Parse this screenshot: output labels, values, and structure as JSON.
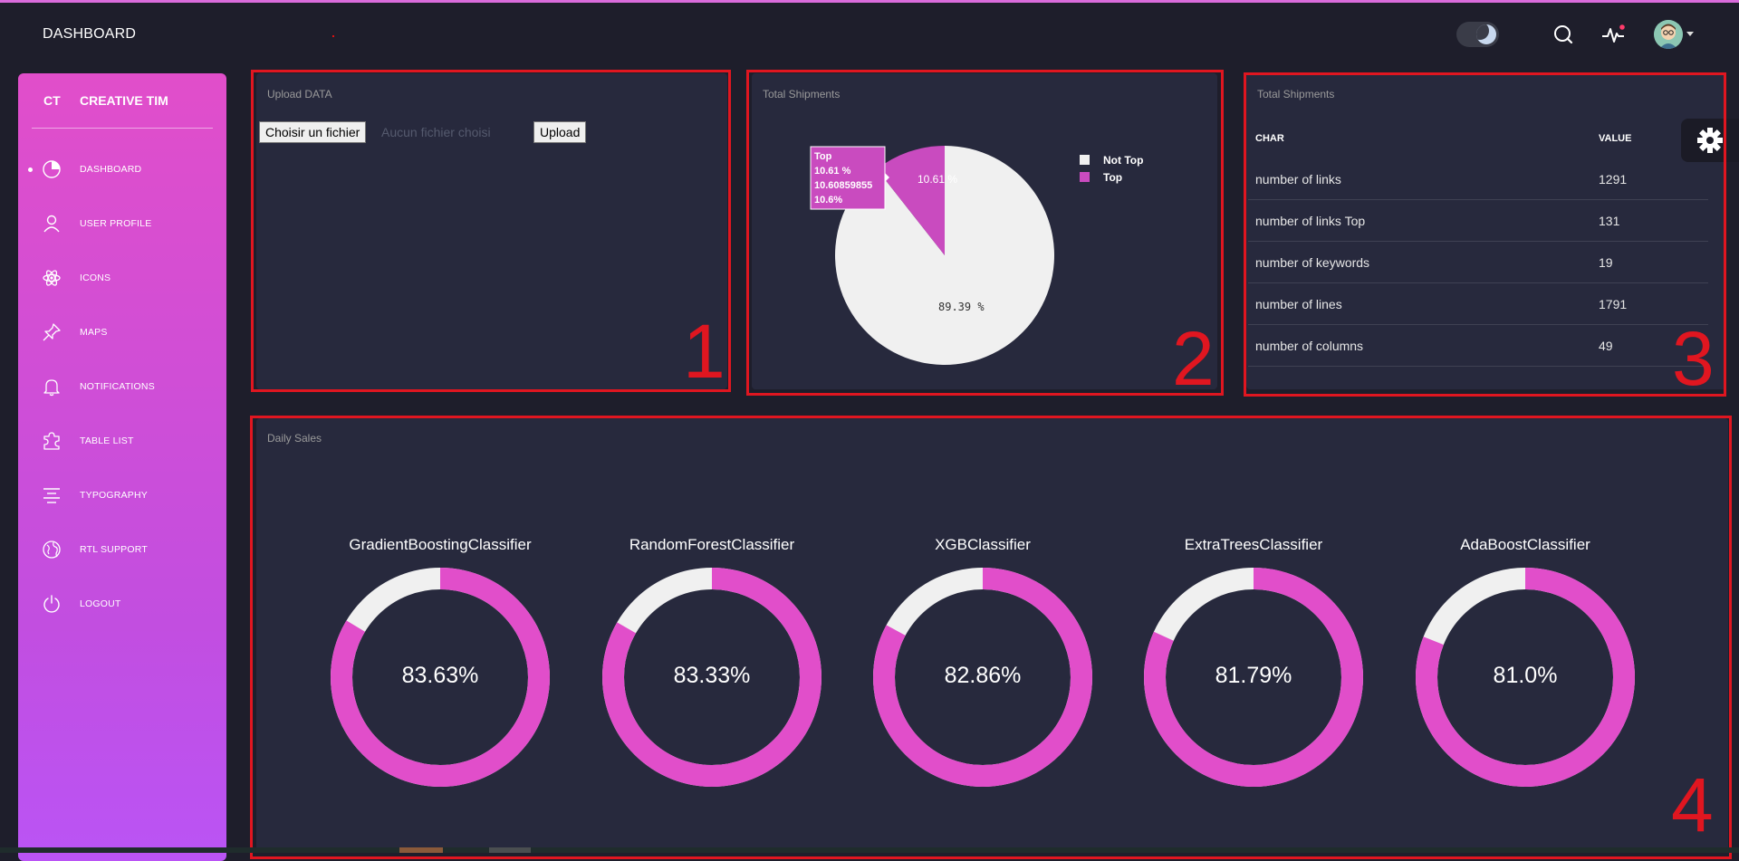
{
  "header": {
    "title": "DASHBOARD"
  },
  "sidebar": {
    "logo_short": "CT",
    "logo_text": "CREATIVE TIM",
    "items": [
      {
        "label": "DASHBOARD",
        "icon": "chart-pie-icon",
        "active": true
      },
      {
        "label": "USER PROFILE",
        "icon": "user-icon",
        "active": false
      },
      {
        "label": "ICONS",
        "icon": "atom-icon",
        "active": false
      },
      {
        "label": "MAPS",
        "icon": "pin-icon",
        "active": false
      },
      {
        "label": "NOTIFICATIONS",
        "icon": "bell-icon",
        "active": false
      },
      {
        "label": "TABLE LIST",
        "icon": "puzzle-icon",
        "active": false
      },
      {
        "label": "TYPOGRAPHY",
        "icon": "align-center-icon",
        "active": false
      },
      {
        "label": "RTL SUPPORT",
        "icon": "world-icon",
        "active": false
      },
      {
        "label": "LOGOUT",
        "icon": "power-icon",
        "active": false
      }
    ]
  },
  "annotations": {
    "n1": "1",
    "n2": "2",
    "n3": "3",
    "n4": "4"
  },
  "upload": {
    "title": "Upload DATA",
    "choose_label": "Choisir un fichier",
    "no_file": "Aucun fichier choisi",
    "upload_label": "Upload"
  },
  "shipments_chart": {
    "title": "Total Shipments",
    "tooltip": [
      "Top",
      "10.61 %",
      "10.60859855",
      "10.6%"
    ],
    "slice_labels": {
      "top": "10.61 %",
      "not_top": "89.39 %"
    }
  },
  "shipments_table": {
    "title": "Total Shipments",
    "headers": [
      "CHAR",
      "VALUE"
    ],
    "rows": [
      [
        "number of links",
        "1291"
      ],
      [
        "number of links Top",
        "131"
      ],
      [
        "number of keywords",
        "19"
      ],
      [
        "number of lines",
        "1791"
      ],
      [
        "number of columns",
        "49"
      ]
    ]
  },
  "daily_sales": {
    "title": "Daily Sales",
    "models": [
      {
        "name": "GradientBoostingClassifier",
        "label": "83.63%"
      },
      {
        "name": "RandomForestClassifier",
        "label": "83.33%"
      },
      {
        "name": "XGBClassifier",
        "label": "82.86%"
      },
      {
        "name": "ExtraTreesClassifier",
        "label": "81.79%"
      },
      {
        "name": "AdaBoostClassifier",
        "label": "81.0%"
      }
    ]
  },
  "colors": {
    "accent": "#e14eca",
    "slice_light": "#f0f0f0",
    "annotation_red": "#e01620",
    "card": "#27293d"
  },
  "chart_data": [
    {
      "type": "pie",
      "title": "Total Shipments",
      "categories": [
        "Not Top",
        "Top"
      ],
      "values": [
        89.39,
        10.61
      ],
      "legend": "top-right"
    },
    {
      "type": "pie",
      "title": "Daily Sales",
      "categories": [
        "GradientBoostingClassifier",
        "RandomForestClassifier",
        "XGBClassifier",
        "ExtraTreesClassifier",
        "AdaBoostClassifier"
      ],
      "values": [
        83.63,
        83.33,
        82.86,
        81.79,
        81.0
      ]
    }
  ]
}
